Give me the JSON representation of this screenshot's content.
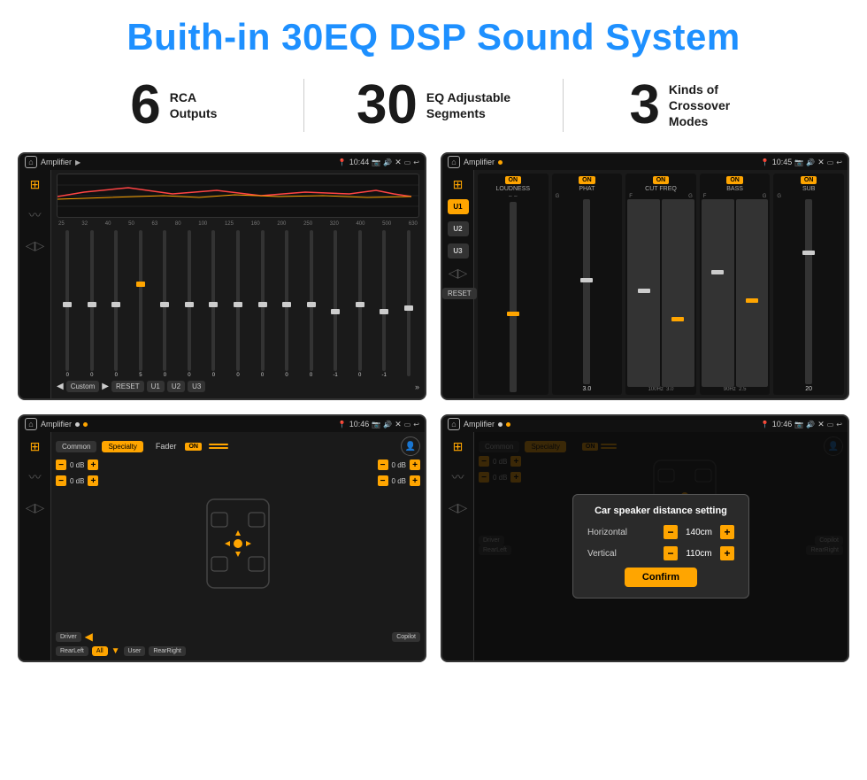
{
  "page": {
    "title": "Buith-in 30EQ DSP Sound System",
    "stats": [
      {
        "number": "6",
        "label": "RCA\nOutputs"
      },
      {
        "number": "30",
        "label": "EQ Adjustable\nSegments"
      },
      {
        "number": "3",
        "label": "Kinds of\nCrossover Modes"
      }
    ],
    "screens": [
      {
        "id": "eq-screen",
        "title": "Amplifier",
        "time": "10:44",
        "type": "equalizer"
      },
      {
        "id": "crossover-screen",
        "title": "Amplifier",
        "time": "10:45",
        "type": "crossover"
      },
      {
        "id": "fader-screen",
        "title": "Amplifier",
        "time": "10:46",
        "type": "fader"
      },
      {
        "id": "distance-screen",
        "title": "Amplifier",
        "time": "10:46",
        "type": "distance"
      }
    ],
    "eq": {
      "frequencies": [
        "25",
        "32",
        "40",
        "50",
        "63",
        "80",
        "100",
        "125",
        "160",
        "200",
        "250",
        "320",
        "400",
        "500",
        "630"
      ],
      "values": [
        "0",
        "0",
        "0",
        "5",
        "0",
        "0",
        "0",
        "0",
        "0",
        "0",
        "0",
        "-1",
        "0",
        "-1",
        ""
      ],
      "preset": "Custom",
      "buttons": [
        "RESET",
        "U1",
        "U2",
        "U3"
      ]
    },
    "crossover": {
      "users": [
        "U1",
        "U2",
        "U3"
      ],
      "controls": [
        {
          "label": "LOUDNESS",
          "on": true,
          "value": ""
        },
        {
          "label": "PHAT",
          "on": true,
          "value": "G"
        },
        {
          "label": "CUT FREQ",
          "on": true,
          "value": "F"
        },
        {
          "label": "BASS",
          "on": true,
          "value": ""
        },
        {
          "label": "SUB",
          "on": true,
          "value": "G"
        }
      ]
    },
    "fader": {
      "tabs": [
        "Common",
        "Specialty"
      ],
      "fader_label": "Fader",
      "on": "ON",
      "positions": {
        "driver": "Driver",
        "copilot": "Copilot",
        "rear_left": "RearLeft",
        "rear_right": "RearRight",
        "all": "All",
        "user": "User"
      },
      "db_values": [
        "0 dB",
        "0 dB",
        "0 dB",
        "0 dB"
      ]
    },
    "distance": {
      "tabs": [
        "Common",
        "Specialty"
      ],
      "on": "ON",
      "modal": {
        "title": "Car speaker distance setting",
        "horizontal_label": "Horizontal",
        "horizontal_value": "140cm",
        "vertical_label": "Vertical",
        "vertical_value": "110cm",
        "confirm_label": "Confirm"
      },
      "positions": {
        "driver": "Driver",
        "copilot": "Copilot",
        "rear_left": "RearLeft",
        "rear_right": "RearRight"
      },
      "db_values": [
        "0 dB",
        "0 dB"
      ]
    }
  }
}
